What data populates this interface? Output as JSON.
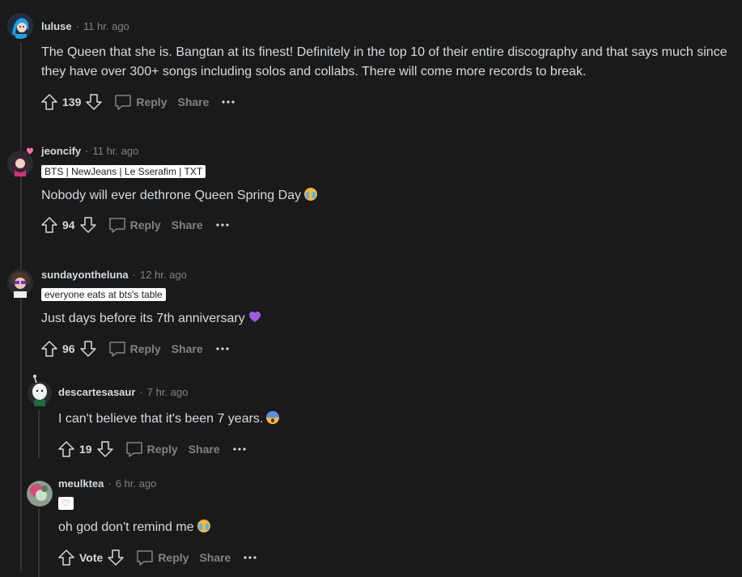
{
  "comments": [
    {
      "author": "luluse",
      "time": "11 hr. ago",
      "flair": "",
      "text": "The Queen that she is. Bangtan at its finest! Definitely in the top 10 of their entire discography and that says much since they have over 300+ songs including solos and collabs. There will come more records to break.",
      "score": "139",
      "reply_label": "Reply",
      "share_label": "Share"
    },
    {
      "author": "jeoncify",
      "time": "11 hr. ago",
      "flair": "BTS | NewJeans | Le Sserafim | TXT",
      "text": "Nobody will ever dethrone Queen Spring Day",
      "emoji": "loudly-crying-face",
      "score": "94",
      "reply_label": "Reply",
      "share_label": "Share"
    },
    {
      "author": "sundayontheluna",
      "time": "12 hr. ago",
      "flair": "everyone eats at bts's table",
      "text": "Just days before its 7th anniversary",
      "emoji": "purple-heart",
      "score": "96",
      "reply_label": "Reply",
      "share_label": "Share"
    },
    {
      "author": "descartesasaur",
      "time": "7 hr. ago",
      "flair": "",
      "text": "I can't believe that it's been 7 years.",
      "emoji": "face-screaming-in-fear",
      "score": "19",
      "reply_label": "Reply",
      "share_label": "Share"
    },
    {
      "author": "meulktea",
      "time": "6 hr. ago",
      "flair": "♡",
      "text": "oh god don't remind me",
      "emoji": "loudly-crying-face",
      "score": "Vote",
      "reply_label": "Reply",
      "share_label": "Share"
    }
  ],
  "separator": "·",
  "colors": {
    "background": "#1a1a1b",
    "text": "#d7dadc",
    "muted": "#818384",
    "thread_line": "#343536",
    "flair_bg": "#ffffff"
  }
}
